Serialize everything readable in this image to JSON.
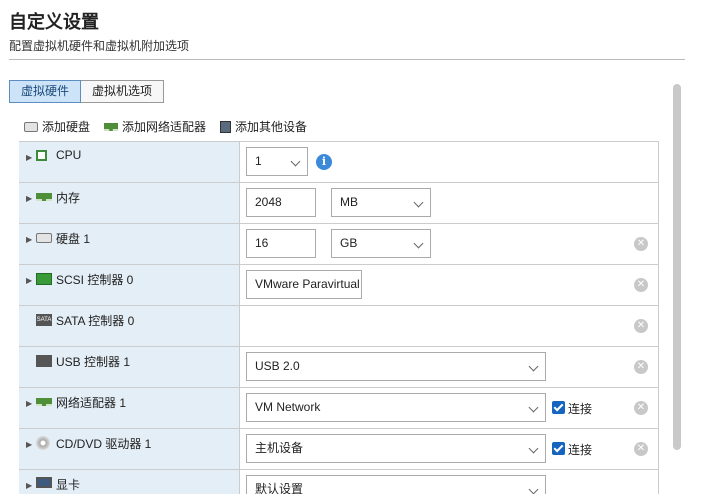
{
  "header": {
    "title": "自定义设置",
    "subtitle": "配置虚拟机硬件和虚拟机附加选项"
  },
  "tabs": [
    {
      "label": "虚拟硬件",
      "active": true
    },
    {
      "label": "虚拟机选项",
      "active": false
    }
  ],
  "toolbar": {
    "add_disk": "添加硬盘",
    "add_network": "添加网络适配器",
    "add_other": "添加其他设备"
  },
  "rows": {
    "cpu": {
      "label": "CPU",
      "value": "1",
      "icon": "cpu-chip-icon"
    },
    "memory": {
      "label": "内存",
      "value": "2048",
      "unit": "MB",
      "icon": "memory-icon"
    },
    "disk": {
      "label": "硬盘 1",
      "value": "16",
      "unit": "GB",
      "icon": "hard-disk-icon"
    },
    "scsi": {
      "label": "SCSI 控制器 0",
      "value": "VMware Paravirtual",
      "icon": "scsi-icon"
    },
    "sata": {
      "label": "SATA 控制器 0",
      "icon": "sata-icon"
    },
    "usb": {
      "label": "USB 控制器 1",
      "value": "USB 2.0",
      "icon": "usb-icon"
    },
    "network": {
      "label": "网络适配器 1",
      "value": "VM Network",
      "connect_label": "连接",
      "connected": true,
      "icon": "network-adapter-icon"
    },
    "cddvd": {
      "label": "CD/DVD 驱动器 1",
      "value": "主机设备",
      "connect_label": "连接",
      "connected": true,
      "icon": "cd-dvd-icon"
    },
    "display": {
      "label": "显卡",
      "value": "默认设置",
      "icon": "display-icon"
    }
  },
  "colors": {
    "label_bg": "#e4eef6",
    "active_tab_bg": "#cde4f8",
    "accent": "#1565c0",
    "info": "#3b8ad9"
  }
}
